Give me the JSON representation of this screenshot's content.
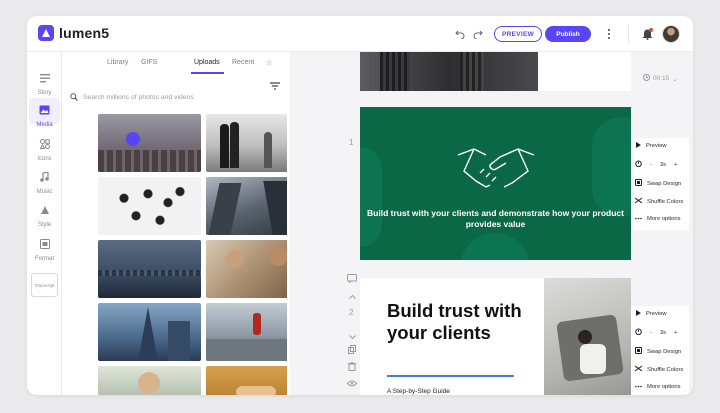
{
  "app": {
    "name": "lumen5"
  },
  "toolbar": {
    "preview_label": "PREVIEW",
    "publish_label": "Publish"
  },
  "rail": {
    "items": [
      {
        "label": "Story",
        "icon": "story-icon"
      },
      {
        "label": "Media",
        "icon": "media-icon",
        "active": true
      },
      {
        "label": "Icons",
        "icon": "icons-icon"
      },
      {
        "label": "Music",
        "icon": "music-icon"
      },
      {
        "label": "Style",
        "icon": "style-icon"
      },
      {
        "label": "Format",
        "icon": "format-icon"
      }
    ],
    "transcript_label": "Transcript"
  },
  "media": {
    "tabs": [
      "Library",
      "GIFS",
      "Uploads",
      "Recent"
    ],
    "active_tab": "Uploads",
    "search_placeholder": "Search millions of photos and videos"
  },
  "timeline": {
    "duration": "00:15"
  },
  "scenes": [
    {
      "number": "1",
      "text": "Build trust with your clients and demonstrate how your product provides value",
      "background": "#0a6847",
      "options": {
        "preview": "Preview",
        "duration": "3s",
        "minus": "-",
        "plus": "+",
        "swap": "Swap Design",
        "shuffle": "Shuffle Colors",
        "more": "More options"
      }
    },
    {
      "number": "2",
      "title": "Build trust with your clients",
      "subtitle": "A Step-by-Step Guide",
      "options": {
        "preview": "Preview",
        "duration": "3s",
        "minus": "-",
        "plus": "+",
        "swap": "Swap Design",
        "shuffle": "Shuffle Colors",
        "more": "More options"
      }
    }
  ],
  "colors": {
    "accent": "#5846f6",
    "scene1_bg": "#0a6847",
    "underline": "#3f7fd8"
  }
}
